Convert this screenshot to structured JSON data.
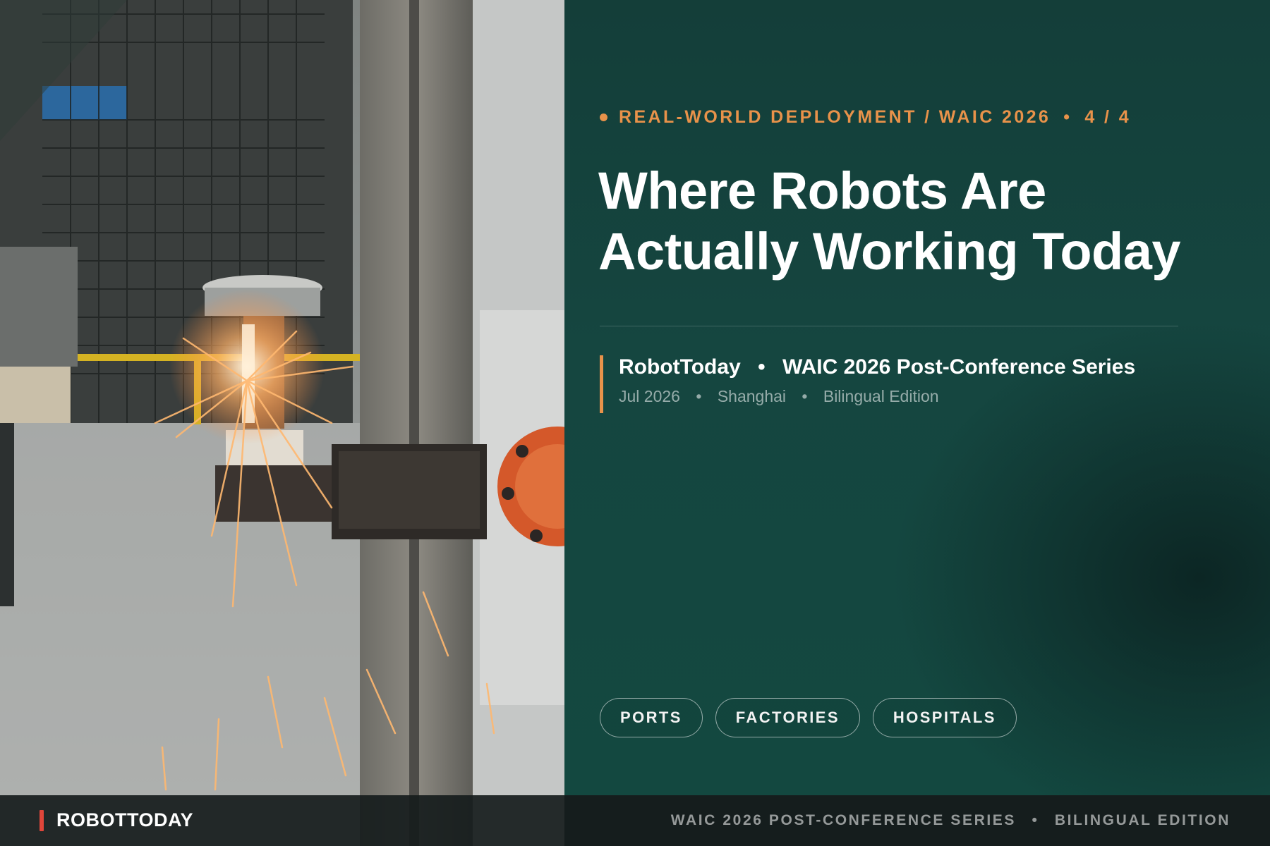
{
  "photo": {
    "description_icon": "welding-robot-photo"
  },
  "header": {
    "section": "REAL-WORLD DEPLOYMENT / WAIC 2026",
    "separator": "•",
    "page_indicator": "4 / 4"
  },
  "headline": {
    "line1": "Where Robots Are",
    "line2": "Actually Working Today"
  },
  "byline": {
    "publisher": "RobotToday",
    "separator": "•",
    "series": "WAIC 2026 Post-Conference Series",
    "date": "Jul 2026",
    "location": "Shanghai",
    "edition": "Bilingual Edition"
  },
  "tags": [
    {
      "label": "PORTS"
    },
    {
      "label": "FACTORIES"
    },
    {
      "label": "HOSPITALS"
    }
  ],
  "footer": {
    "brand": "ROBOTTODAY",
    "series": "WAIC 2026 POST-CONFERENCE SERIES",
    "separator": "•",
    "edition": "BILINGUAL EDITION"
  },
  "colors": {
    "accent": "#e8924a",
    "brand_mark": "#e0463a",
    "panel": "#154640"
  }
}
